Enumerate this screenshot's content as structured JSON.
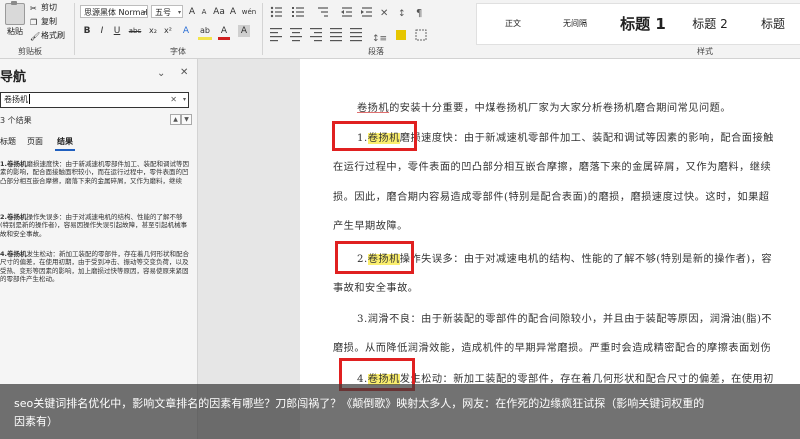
{
  "ribbon": {
    "clipboard": {
      "paste": "粘贴",
      "cut": "剪切",
      "copy": "复制",
      "format_painter": "格式刷",
      "group": "剪贴板"
    },
    "font": {
      "family": "思源黑体 Normal",
      "size": "五号",
      "grow": "A",
      "shrink": "A",
      "case": "Aa",
      "clear": "A",
      "wen": "wén",
      "bold": "B",
      "italic": "I",
      "underline": "U",
      "strike": "abc",
      "sub": "x₂",
      "sup": "x²",
      "effects": "A",
      "highlight": "ab",
      "color": "A",
      "shade": "A",
      "group": "字体"
    },
    "paragraph": {
      "group": "段落"
    },
    "styles": {
      "items": [
        "正文",
        "无间隔",
        "标题 1",
        "标题 2",
        "标题"
      ],
      "group": "样式"
    }
  },
  "nav": {
    "title": "导航",
    "search_value": "卷扬机",
    "result_count": "3 个结果",
    "tabs": [
      "标题",
      "页面",
      "结果"
    ],
    "results": [
      {
        "keyword": "1.卷扬机",
        "rest": "磨损速度快：由于新减速机零部件加工、装配和调试等因素的影响，配合面接触面积较小，而在运行过程中，零件表面的凹凸部分相互嵌合摩擦，磨落下来的金属碎屑，又作为磨料，继续"
      },
      {
        "keyword": "2.卷扬机",
        "rest": "操作失误多：由于对减速电机的结构、性能的了解不够(特别是新的操作者)，容易因操作失误引起故障，甚至引起机械事故和安全事故。"
      },
      {
        "keyword": "4.卷扬机",
        "rest": "发生松动：新加工装配的零部件，存在着几何形状和配合尺寸的偏差，在使用初期，由于受到冲击、振动等交变负荷，以及受热、变形等因素的影响，加上磨损过快等原因，容易使原来紧固的零部件产生松动。"
      }
    ]
  },
  "doc": {
    "intro_kw": "卷扬机",
    "intro_rest": "的安装十分重要，中煤卷扬机厂家为大家分析卷扬机磨合期间常见问题。",
    "p1_num": "1.",
    "p1_kw": "卷扬机",
    "p1_line1": "磨损速度快：由于新减速机零部件加工、装配和调试等因素的影响，配合面接触",
    "p1_line2": "在运行过程中，零件表面的凹凸部分相互嵌合摩擦，磨落下来的金属碎屑，又作为磨料，继续",
    "p1_line3": "损。因此，磨合期内容易造成零部件(特别是配合表面)的磨损，磨损速度过快。这时，如果超",
    "p1_line4": "产生早期故障。",
    "p2_num": "2.",
    "p2_kw": "卷扬机",
    "p2_line1": "操作失误多：由于对减速电机的结构、性能的了解不够(特别是新的操作者)，容",
    "p2_line2": "事故和安全事故。",
    "p3_line1": "3.润滑不良：由于新装配的零部件的配合间隙较小，并且由于装配等原因，润滑油(脂)不",
    "p3_line2": "磨损。从而降低润滑效能，造成机件的早期异常磨损。严重时会造成精密配合的摩擦表面划伤",
    "p4_num": "4.",
    "p4_kw": "卷扬机",
    "p4_line1": "发生松动：新加工装配的零部件，存在着几何形状和配合尺寸的偏差，在使用初"
  },
  "caption": {
    "line1": "seo关键词排名优化中，影响文章排名的因素有哪些？刀郎闯祸了？《颠倒歌》映射太多人，网友：在作死的边缘疯狂试探（影响关键词权重的",
    "line2": "因素有）"
  },
  "colors": {
    "highlight": "#fbef6e",
    "annotation_box": "#e02020",
    "nav_tab_active": "#1f5fbf"
  }
}
